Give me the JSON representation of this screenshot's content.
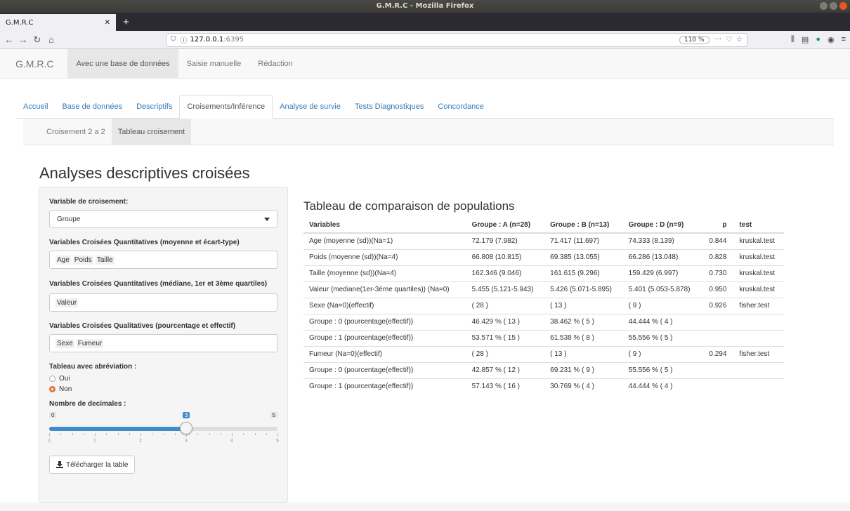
{
  "window": {
    "title": "G.M.R.C - Mozilla Firefox"
  },
  "browser": {
    "tab_title": "G.M.R.C",
    "url_host": "127.0.0.1",
    "url_port": ":6395",
    "zoom": "110 %"
  },
  "app": {
    "brand": "G.M.R.C",
    "nav": [
      "Avec une base de données",
      "Saisie manuelle",
      "Rédaction"
    ],
    "tabs": [
      "Accueil",
      "Base de données",
      "Descriptifs",
      "Croisements/Inférence",
      "Analyse de survie",
      "Tests Diagnostiques",
      "Concordance"
    ],
    "subtabs": [
      "Croisement 2 a 2",
      "Tableau croisement"
    ],
    "page_title": "Analyses descriptives croisées"
  },
  "sidebar": {
    "crossing_label": "Variable de croisement:",
    "crossing_value": "Groupe",
    "quant_mean_label": "Variables Croisées Quantitatives (moyenne et écart-type)",
    "quant_mean_chips": [
      "Age",
      "Poids",
      "Taille"
    ],
    "quant_median_label": "Variables Croisées Quantitatives (médiane, 1er et 3ème quartiles)",
    "quant_median_chips": [
      "Valeur"
    ],
    "qual_label": "Variables Croisées Qualitatives (pourcentage et effectif)",
    "qual_chips": [
      "Sexe",
      "Fumeur"
    ],
    "abbrev_label": "Tableau avec abréviation :",
    "abbrev_options": [
      "Oui",
      "Non"
    ],
    "abbrev_selected": "Non",
    "decimals_label": "Nombre de decimales :",
    "decimals": {
      "min": 0,
      "max": 5,
      "value": 3,
      "min_label": "0",
      "max_label": "5",
      "value_label": "3",
      "tick_labels": [
        "0",
        "1",
        "2",
        "3",
        "4",
        "5"
      ]
    },
    "download_label": "Télécharger la table"
  },
  "table": {
    "title": "Tableau de comparaison de populations",
    "headers": [
      "Variables",
      "Groupe : A (n=28)",
      "Groupe : B (n=13)",
      "Groupe : D (n=9)",
      "p",
      "test"
    ],
    "rows": [
      [
        "Age (moyenne (sd))(Na=1)",
        "72.179 (7.982)",
        "71.417 (11.697)",
        "74.333 (8.139)",
        "0.844",
        "kruskal.test"
      ],
      [
        "Poids (moyenne (sd))(Na=4)",
        "66.808 (10.815)",
        "69.385 (13.055)",
        "66.286 (13.048)",
        "0.828",
        "kruskal.test"
      ],
      [
        "Taille (moyenne (sd))(Na=4)",
        "162.346 (9.046)",
        "161.615 (9.296)",
        "159.429 (6.997)",
        "0.730",
        "kruskal.test"
      ],
      [
        "Valeur (mediane(1er-3ème quartiles)) (Na=0)",
        "5.455 (5.121-5.943)",
        "5.426 (5.071-5.895)",
        "5.401 (5.053-5.878)",
        "0.950",
        "kruskal.test"
      ],
      [
        "Sexe (Na=0)(effectif)",
        "( 28 )",
        "( 13 )",
        "( 9 )",
        "0.926",
        "fisher.test"
      ],
      [
        "Groupe : 0 (pourcentage(effectif))",
        "46.429 % ( 13 )",
        "38.462 % ( 5 )",
        "44.444 % ( 4 )",
        "",
        ""
      ],
      [
        "Groupe : 1 (pourcentage(effectif))",
        "53.571 % ( 15 )",
        "61.538 % ( 8 )",
        "55.556 % ( 5 )",
        "",
        ""
      ],
      [
        "Fumeur (Na=0)(effectif)",
        "( 28 )",
        "( 13 )",
        "( 9 )",
        "0.294",
        "fisher.test"
      ],
      [
        "Groupe : 0 (pourcentage(effectif))",
        "42.857 % ( 12 )",
        "69.231 % ( 9 )",
        "55.556 % ( 5 )",
        "",
        ""
      ],
      [
        "Groupe : 1 (pourcentage(effectif))",
        "57.143 % ( 16 )",
        "30.769 % ( 4 )",
        "44.444 % ( 4 )",
        "",
        ""
      ]
    ]
  }
}
